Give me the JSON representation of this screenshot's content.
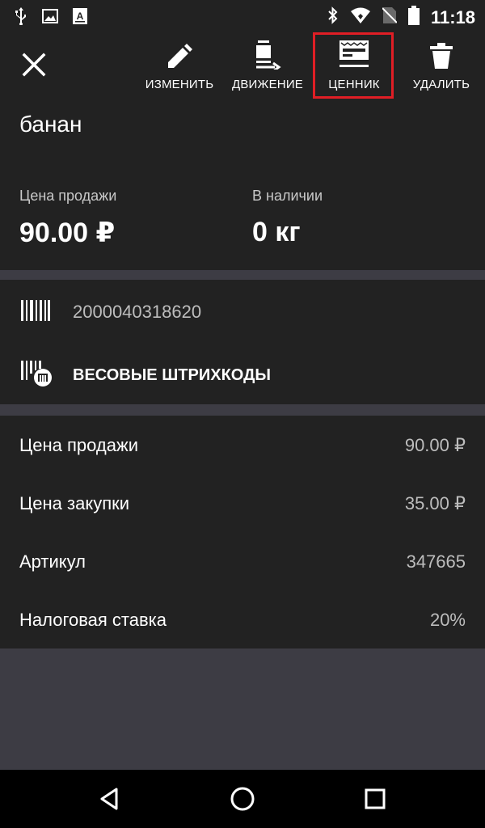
{
  "status_bar": {
    "time": "11:18",
    "icons_left": [
      "usb-icon",
      "image-icon",
      "font-icon"
    ],
    "icons_right": [
      "bluetooth-icon",
      "wifi-icon",
      "no-sim-icon",
      "battery-icon"
    ]
  },
  "toolbar": {
    "close_icon": "close-icon",
    "actions": [
      {
        "label": "ИЗМЕНИТЬ",
        "icon": "pencil-icon"
      },
      {
        "label": "ДВИЖЕНИЕ",
        "icon": "movement-icon"
      },
      {
        "label": "ЦЕННИК",
        "icon": "price-tag-icon"
      },
      {
        "label": "УДАЛИТЬ",
        "icon": "trash-icon"
      }
    ],
    "highlight_color": "#e01e25"
  },
  "product": {
    "name": "банан",
    "sale_price_label": "Цена продажи",
    "sale_price_value": "90.00 ₽",
    "stock_label": "В наличии",
    "stock_value": "0 кг"
  },
  "barcodes": {
    "barcode_value": "2000040318620",
    "weight_barcodes_label": "ВЕСОВЫЕ ШТРИХКОДЫ"
  },
  "details": [
    {
      "label": "Цена продажи",
      "value": "90.00 ₽"
    },
    {
      "label": "Цена закупки",
      "value": "35.00 ₽"
    },
    {
      "label": "Артикул",
      "value": "347665"
    },
    {
      "label": "Налоговая ставка",
      "value": "20%"
    }
  ],
  "nav_bar": {
    "buttons": [
      "back-icon",
      "home-icon",
      "recents-icon"
    ]
  },
  "colors": {
    "surface": "#222222",
    "background": "#3d3c44",
    "secondary_text": "#bdbdbd"
  }
}
